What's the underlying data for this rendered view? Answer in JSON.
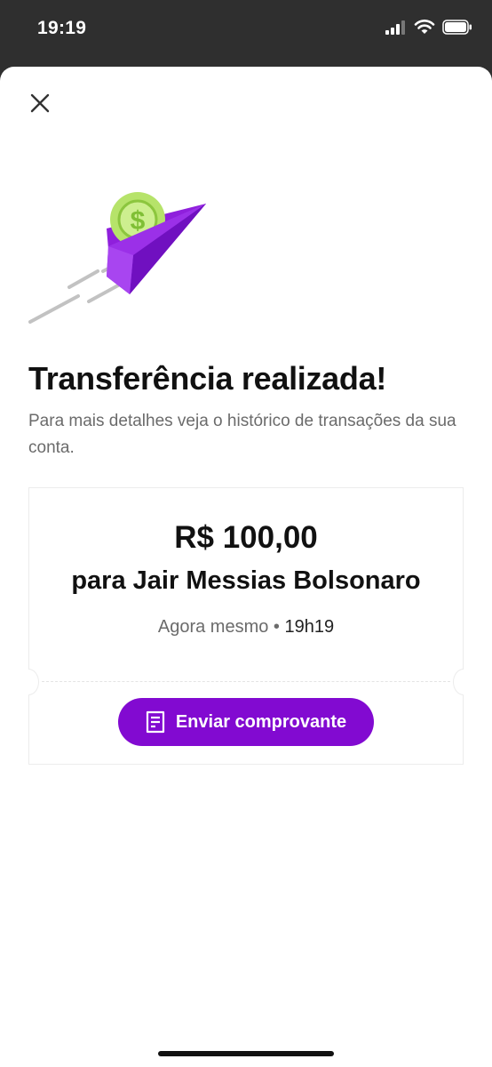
{
  "status_bar": {
    "time": "19:19",
    "icons": [
      "signal-icon",
      "wifi-icon",
      "battery-icon"
    ]
  },
  "sheet": {
    "close_icon": "close-icon",
    "illustration": "paper-plane-coin-icon",
    "title": "Transferência realizada!",
    "subtitle": "Para mais detalhes veja o histórico de transações da sua conta."
  },
  "receipt": {
    "amount": "R$ 100,00",
    "recipient": "para Jair Messias Bolsonaro",
    "when": "Agora mesmo",
    "separator": "•",
    "time": "19h19",
    "button_label": "Enviar comprovante",
    "button_icon": "receipt-icon"
  },
  "colors": {
    "accent": "#820ad1",
    "coin": "#b6e36a",
    "text_primary": "#111111",
    "text_secondary": "#6b6b6b"
  }
}
